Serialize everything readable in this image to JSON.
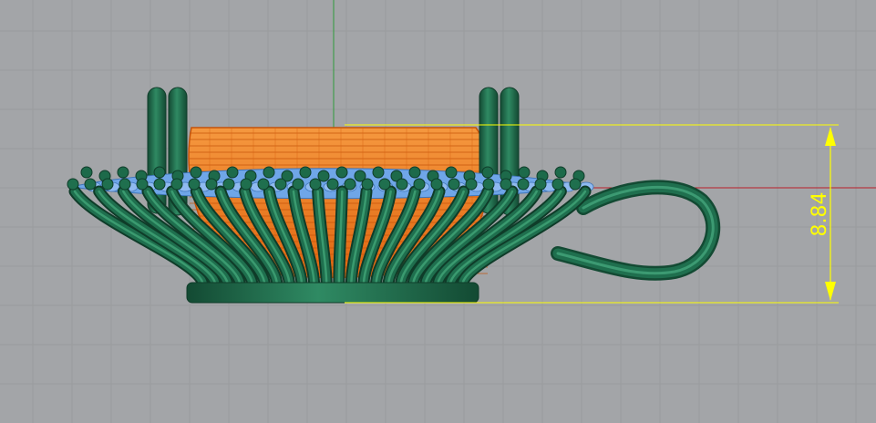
{
  "viewport": {
    "background_color": "#a3a5a8",
    "grid_minor_color": "#999b9e",
    "grid_major_color": "#8e9094",
    "axis_x_color": "#b81f2a",
    "axis_y_color": "#2f9c3a"
  },
  "model": {
    "prong_color": "#1f6f4e",
    "stone_color": "#f07a1c",
    "seat_color": "#6fa6e8"
  },
  "dimension": {
    "value": "8.84",
    "color": "#ffff00"
  }
}
